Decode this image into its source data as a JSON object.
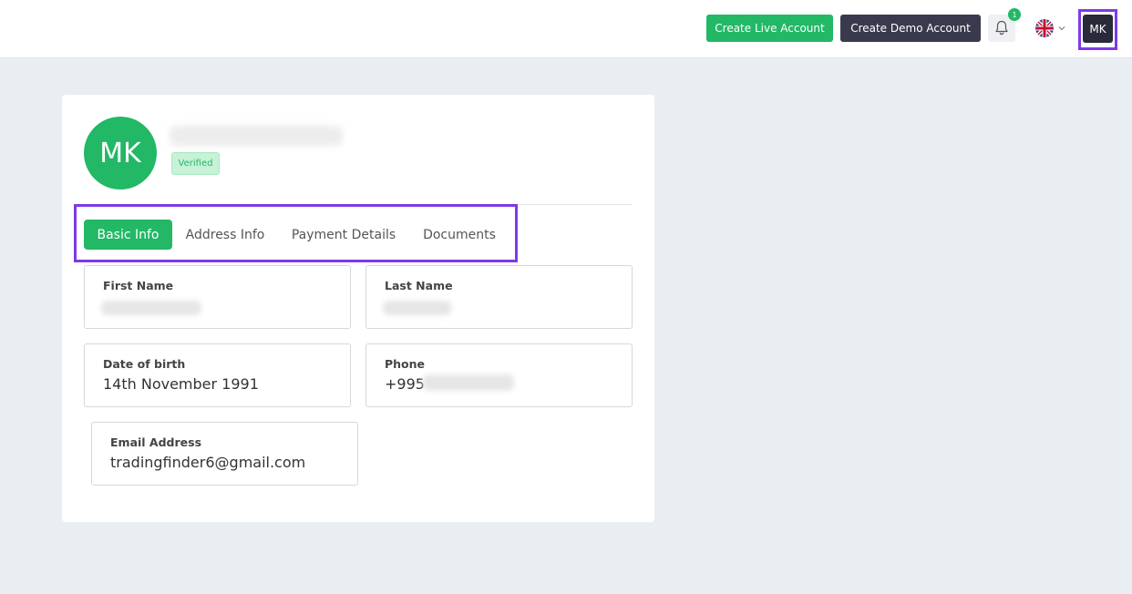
{
  "header": {
    "create_live_label": "Create Live Account",
    "create_demo_label": "Create Demo Account",
    "notification_count": "1",
    "user_initials": "MK"
  },
  "profile": {
    "initials": "MK",
    "status_badge": "Verified"
  },
  "tabs": [
    {
      "label": "Basic Info",
      "active": true
    },
    {
      "label": "Address Info",
      "active": false
    },
    {
      "label": "Payment Details",
      "active": false
    },
    {
      "label": "Documents",
      "active": false
    }
  ],
  "fields": {
    "first_name": {
      "label": "First Name",
      "value": ""
    },
    "last_name": {
      "label": "Last Name",
      "value": ""
    },
    "date_of_birth": {
      "label": "Date of birth",
      "value": "14th November 1991"
    },
    "phone": {
      "label": "Phone",
      "value": "+995"
    },
    "email": {
      "label": "Email Address",
      "value": "tradingfinder6@gmail.com"
    }
  },
  "colors": {
    "accent_green": "#22b866",
    "dark_button": "#393a4d",
    "highlight_purple": "#7f39e6",
    "page_background": "#e9eef2"
  },
  "icons": {
    "notifications": "bell-icon",
    "language": "uk-flag-icon",
    "dropdown": "chevron-down-icon"
  }
}
